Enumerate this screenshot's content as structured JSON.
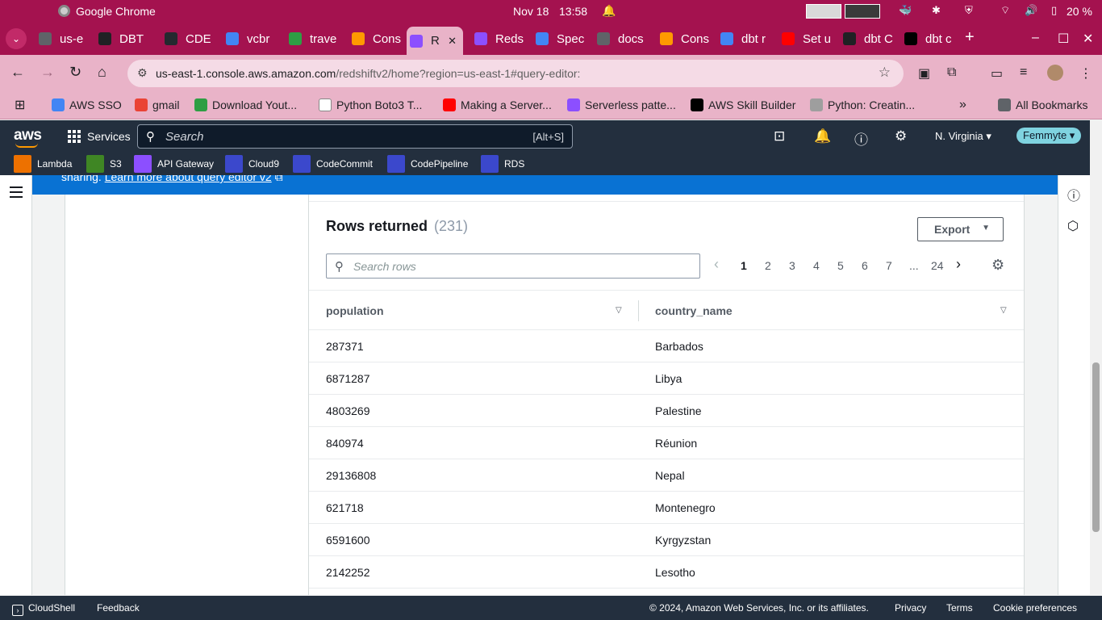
{
  "os": {
    "app_name": "Google Chrome",
    "date": "Nov 18",
    "time": "13:58",
    "battery": "20 %"
  },
  "tabs": [
    {
      "label": "us-e",
      "color": "#5f6368",
      "active": false
    },
    {
      "label": "DBT",
      "color": "#202124",
      "active": false
    },
    {
      "label": "CDE",
      "color": "#24292f",
      "active": false
    },
    {
      "label": "vcbr",
      "color": "#4285f4",
      "active": false
    },
    {
      "label": "trave",
      "color": "#2e9e44",
      "active": false
    },
    {
      "label": "Cons",
      "color": "#ff9900",
      "active": false
    },
    {
      "label": "R",
      "color": "#8c4fff",
      "active": true
    },
    {
      "label": "Reds",
      "color": "#8c4fff",
      "active": false
    },
    {
      "label": "Spec",
      "color": "#4285f4",
      "active": false
    },
    {
      "label": "docs",
      "color": "#5f6368",
      "active": false
    },
    {
      "label": "Cons",
      "color": "#ff9900",
      "active": false
    },
    {
      "label": "dbt r",
      "color": "#4285f4",
      "active": false
    },
    {
      "label": "Set u",
      "color": "#ff0000",
      "active": false
    },
    {
      "label": "dbt C",
      "color": "#202124",
      "active": false
    },
    {
      "label": "dbt c",
      "color": "#000000",
      "active": false
    }
  ],
  "address": {
    "url_host": "us-east-1.console.aws.amazon.com",
    "url_path": "/redshiftv2/home?region=us-east-1#query-editor:"
  },
  "bookmarks": [
    {
      "label": "AWS SSO",
      "color": "#4285f4"
    },
    {
      "label": "gmail",
      "color": "#ea4335"
    },
    {
      "label": "Download Yout...",
      "color": "#2e9e44"
    },
    {
      "label": "Python Boto3 T...",
      "color": "#ffffff"
    },
    {
      "label": "Making a Server...",
      "color": "#ff0000"
    },
    {
      "label": "Serverless patte...",
      "color": "#8c4fff"
    },
    {
      "label": "AWS Skill Builder",
      "color": "#000000"
    },
    {
      "label": "Python: Creatin...",
      "color": "#9e9e9e"
    },
    {
      "label": "All Bookmarks",
      "color": "#5f6368"
    }
  ],
  "aws": {
    "services_label": "Services",
    "search_placeholder": "Search",
    "search_hint": "[Alt+S]",
    "region": "N. Virginia",
    "user": "Femmyte",
    "favorites": [
      {
        "label": "Lambda",
        "color": "#ed7100"
      },
      {
        "label": "S3",
        "color": "#3f8624"
      },
      {
        "label": "API Gateway",
        "color": "#8c4fff"
      },
      {
        "label": "Cloud9",
        "color": "#3b48cc"
      },
      {
        "label": "CodeCommit",
        "color": "#3b48cc"
      },
      {
        "label": "CodePipeline",
        "color": "#3b48cc"
      },
      {
        "label": "RDS",
        "color": "#3b48cc"
      }
    ]
  },
  "banner": {
    "prefix": "sharing.",
    "link": "Learn more about query editor v2"
  },
  "results": {
    "title": "Rows returned",
    "count": "(231)",
    "export_label": "Export",
    "search_placeholder": "Search rows",
    "pages": [
      "1",
      "2",
      "3",
      "4",
      "5",
      "6",
      "7",
      "...",
      "24"
    ],
    "current_page": "1",
    "columns": [
      "population",
      "country_name"
    ],
    "rows": [
      [
        "287371",
        "Barbados"
      ],
      [
        "6871287",
        "Libya"
      ],
      [
        "4803269",
        "Palestine"
      ],
      [
        "840974",
        "Réunion"
      ],
      [
        "29136808",
        "Nepal"
      ],
      [
        "621718",
        "Montenegro"
      ],
      [
        "6591600",
        "Kyrgyzstan"
      ],
      [
        "2142252",
        "Lesotho"
      ]
    ]
  },
  "footer": {
    "cloudshell": "CloudShell",
    "feedback": "Feedback",
    "copyright": "© 2024, Amazon Web Services, Inc. or its affiliates.",
    "privacy": "Privacy",
    "terms": "Terms",
    "cookies": "Cookie preferences"
  }
}
